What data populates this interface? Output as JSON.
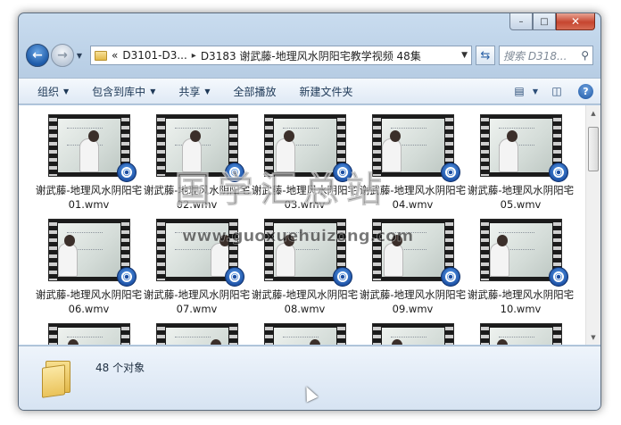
{
  "window": {
    "caption_buttons": [
      "–",
      "□",
      "✕"
    ]
  },
  "nav": {
    "back_glyph": "←",
    "forward_glyph": "→",
    "address": {
      "overflow": "«",
      "crumbs": [
        "D3101-D3...",
        "D3183 谢武藤-地理风水阴阳宅教学视频 48集"
      ],
      "separator": "▸"
    },
    "search_placeholder": "搜索 D318...",
    "refresh_icon": "refresh-icon",
    "search_icon": "search-icon"
  },
  "toolbar": {
    "organize": "组织",
    "include_in_library": "包含到库中",
    "share": "共享",
    "play_all": "全部播放",
    "new_folder": "新建文件夹"
  },
  "files": [
    {
      "name": "谢武藤-地理风水阴阳宅01.wmv"
    },
    {
      "name": "谢武藤-地理风水阴阳宅02.wmv"
    },
    {
      "name": "谢武藤-地理风水阴阳宅03.wmv"
    },
    {
      "name": "谢武藤-地理风水阴阳宅04.wmv"
    },
    {
      "name": "谢武藤-地理风水阴阳宅05.wmv"
    },
    {
      "name": "谢武藤-地理风水阴阳宅06.wmv"
    },
    {
      "name": "谢武藤-地理风水阴阳宅07.wmv"
    },
    {
      "name": "谢武藤-地理风水阴阳宅08.wmv"
    },
    {
      "name": "谢武藤-地理风水阴阳宅09.wmv"
    },
    {
      "name": "谢武藤-地理风水阴阳宅10.wmv"
    },
    {
      "name": ""
    },
    {
      "name": ""
    },
    {
      "name": ""
    },
    {
      "name": ""
    },
    {
      "name": ""
    }
  ],
  "details": {
    "count_text": "48 个对象"
  },
  "watermark": {
    "title": "国学汇总站",
    "url": "www.guoxuehuizong.com"
  },
  "colors": {
    "accent": "#1d5aa8",
    "frame": "#b7cde4",
    "close_button": "#c6452f"
  }
}
